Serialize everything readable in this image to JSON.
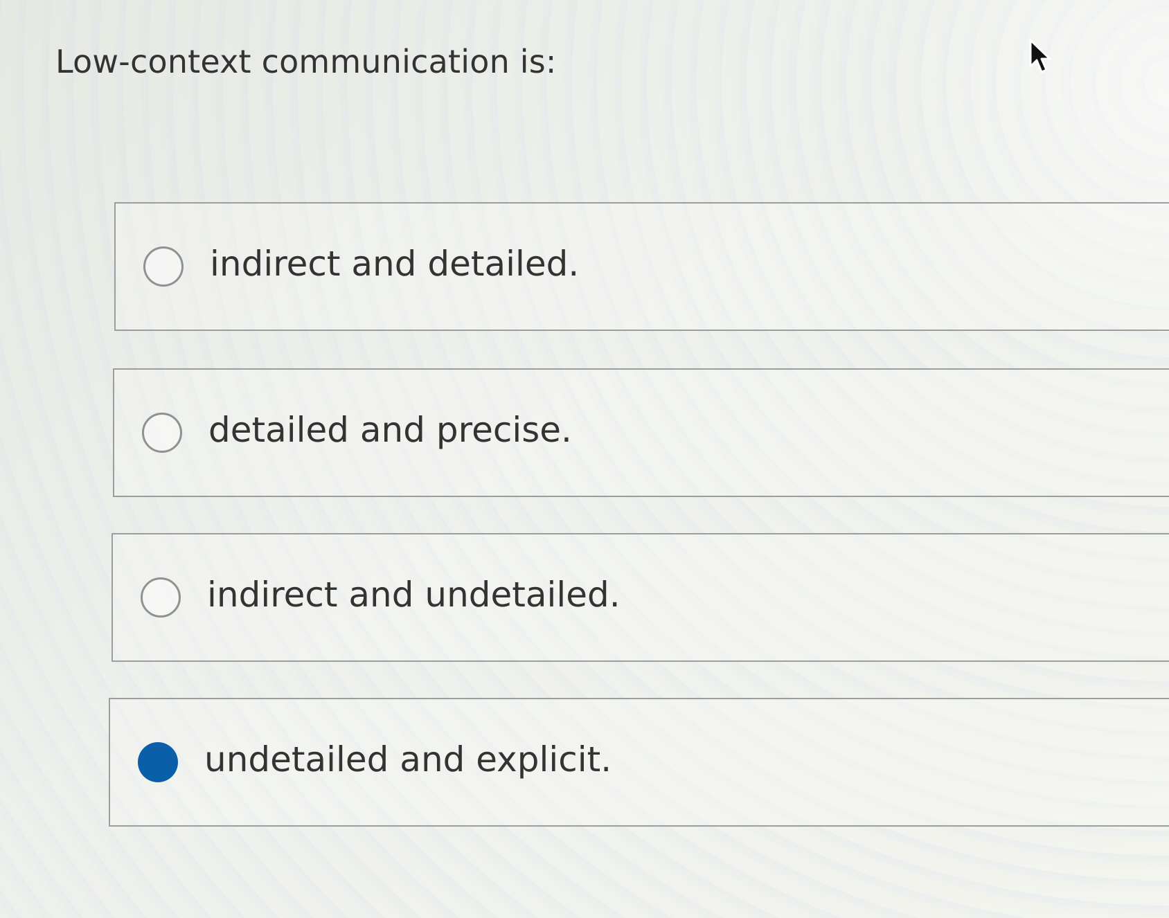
{
  "question": {
    "text": "Low-context communication is:"
  },
  "options": [
    {
      "label": "indirect and detailed.",
      "selected": false
    },
    {
      "label": "detailed and precise.",
      "selected": false
    },
    {
      "label": "indirect and undetailed.",
      "selected": false
    },
    {
      "label": "undetailed and explicit.",
      "selected": true
    }
  ],
  "colors": {
    "selected_radio": "#0b5fa8",
    "border": "#9a9e9c"
  },
  "icons": {
    "cursor": "arrow-cursor-icon",
    "radio": "radio-button-icon"
  }
}
